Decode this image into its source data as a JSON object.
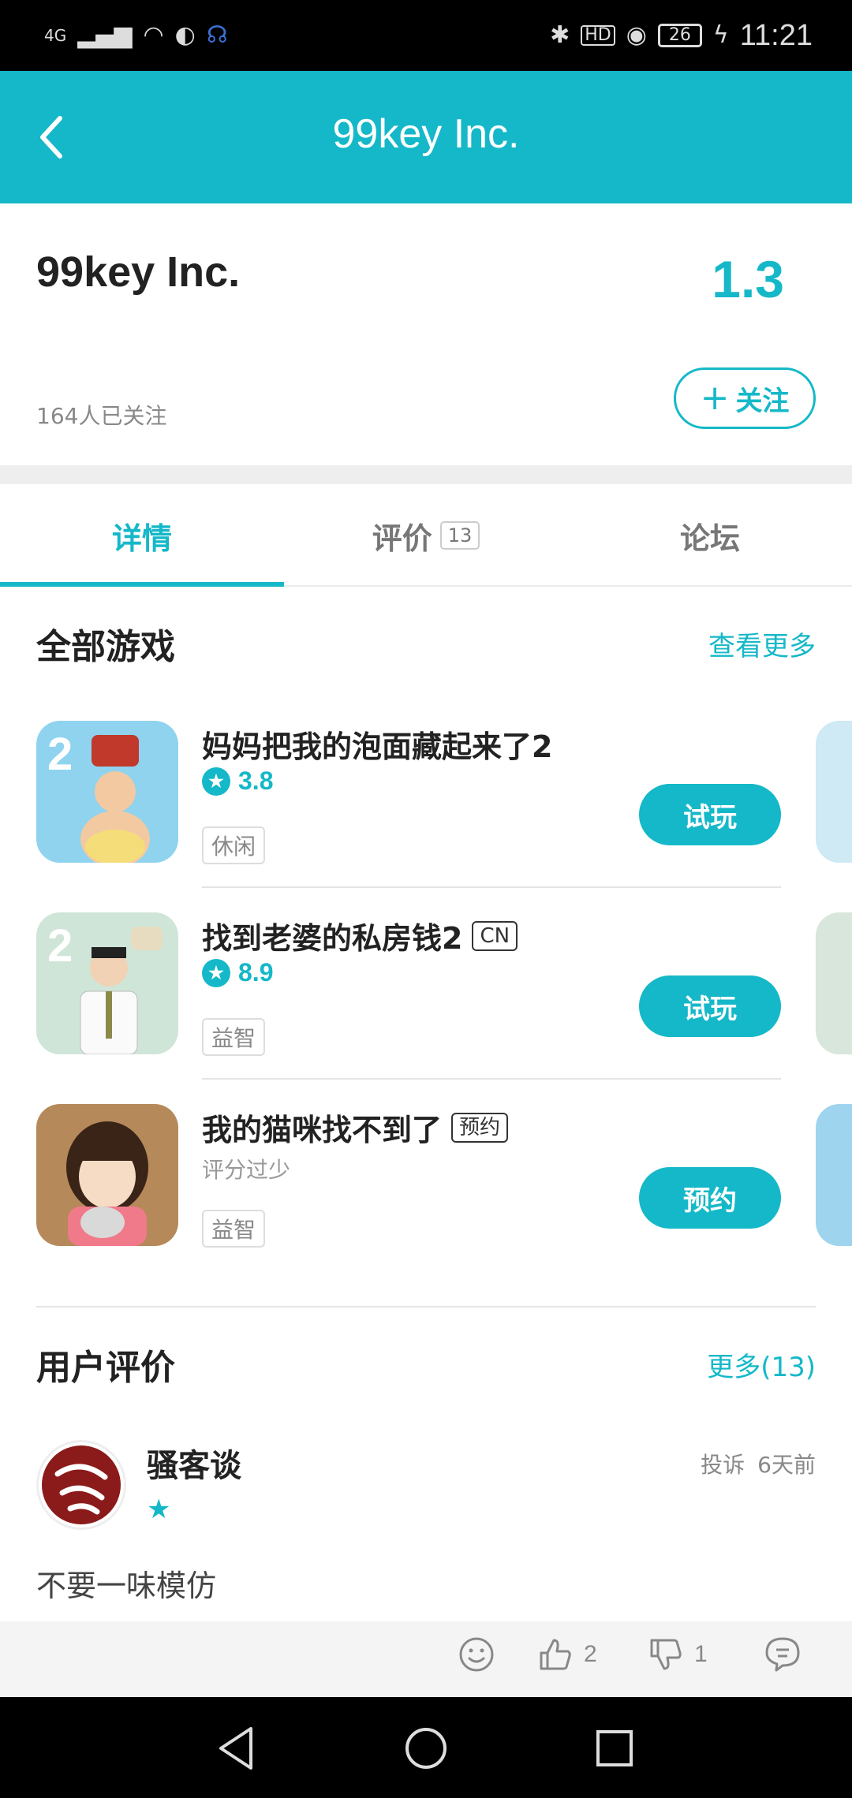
{
  "status_bar": {
    "time": "11:21",
    "battery": "26",
    "network": "4G"
  },
  "header": {
    "title": "99key Inc."
  },
  "company": {
    "name": "99key Inc.",
    "score": "1.3",
    "followers": "164人已关注",
    "follow_label": "关注"
  },
  "tabs": [
    {
      "label": "详情"
    },
    {
      "label": "评价",
      "count": "13"
    },
    {
      "label": "论坛"
    }
  ],
  "games_section": {
    "title": "全部游戏",
    "more": "查看更多"
  },
  "games": [
    {
      "title": "妈妈把我的泡面藏起来了2",
      "rating": "3.8",
      "category": "休闲",
      "button": "试玩",
      "tag": ""
    },
    {
      "title": "找到老婆的私房钱2",
      "rating": "8.9",
      "category": "益智",
      "button": "试玩",
      "tag": "CN"
    },
    {
      "title": "我的猫咪找不到了",
      "rating_text": "评分过少",
      "category": "益智",
      "button": "预约",
      "tag": "预约"
    }
  ],
  "reviews_section": {
    "title": "用户评价",
    "more": "更多(13)"
  },
  "review": {
    "author": "骚客谈",
    "report": "投诉",
    "time": "6天前",
    "text": "不要一味模仿",
    "likes": "2",
    "dislikes": "1"
  },
  "colors": {
    "accent": "#15b8c8"
  }
}
